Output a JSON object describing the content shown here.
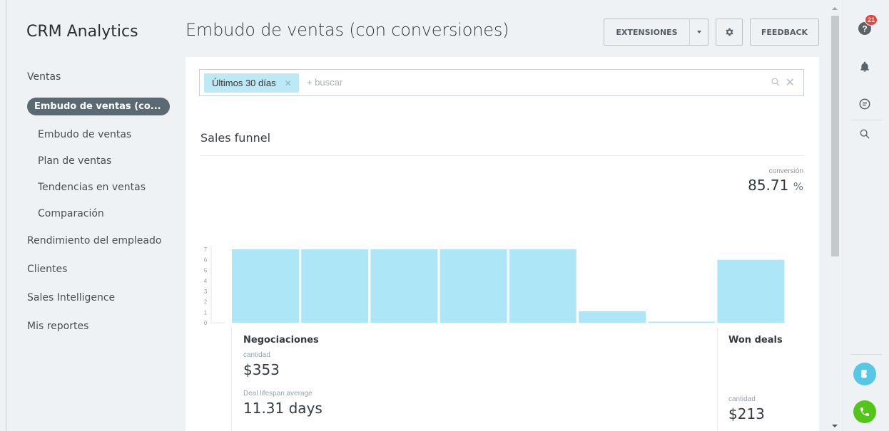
{
  "app": {
    "title": "CRM Analytics"
  },
  "sidebar": {
    "items": [
      {
        "label": "Ventas",
        "level": 0
      },
      {
        "label": "Embudo de ventas (co...",
        "level": 1,
        "active": true
      },
      {
        "label": "Embudo de ventas",
        "level": 1
      },
      {
        "label": "Plan de ventas",
        "level": 1
      },
      {
        "label": "Tendencias en ventas",
        "level": 1
      },
      {
        "label": "Comparación",
        "level": 1
      },
      {
        "label": "Rendimiento del empleado",
        "level": 0
      },
      {
        "label": "Clientes",
        "level": 0
      },
      {
        "label": "Sales Intelligence",
        "level": 0
      },
      {
        "label": "Mis reportes",
        "level": 0
      }
    ]
  },
  "header": {
    "title": "Embudo de ventas (con conversiones)",
    "extensions_label": "EXTENSIONES",
    "feedback_label": "FEEDBACK"
  },
  "filter": {
    "chip_label": "Últimos 30 días",
    "search_placeholder": "+ buscar"
  },
  "report": {
    "section_title": "Sales funnel",
    "conversion_label": "conversión",
    "conversion_value": "85.71",
    "conversion_unit": "%"
  },
  "chart_data": {
    "type": "bar",
    "title": "",
    "xlabel": "",
    "ylabel": "",
    "ylim": [
      0,
      7
    ],
    "yticks": [
      0,
      1,
      2,
      3,
      4,
      5,
      6,
      7
    ],
    "values": [
      7,
      7,
      7,
      7,
      7,
      1.1,
      0.1,
      6
    ],
    "grid": false,
    "bar_color": "#ade7f7"
  },
  "stages": {
    "first": {
      "name": "Negociaciones",
      "amount_label": "cantidad",
      "amount_value": "$353",
      "lifespan_label": "Deal lifespan average",
      "lifespan_value": "11.31 days"
    },
    "last": {
      "name": "Won deals",
      "amount_label": "cantidad",
      "amount_value": "$213"
    }
  },
  "rail": {
    "help_badge": "21"
  },
  "colors": {
    "accent_chip": "#bde8f5",
    "active_nav": "#5a6a72",
    "badge": "#f0413a",
    "open_lines": "#55c8e6",
    "call_button": "#52c41a"
  }
}
